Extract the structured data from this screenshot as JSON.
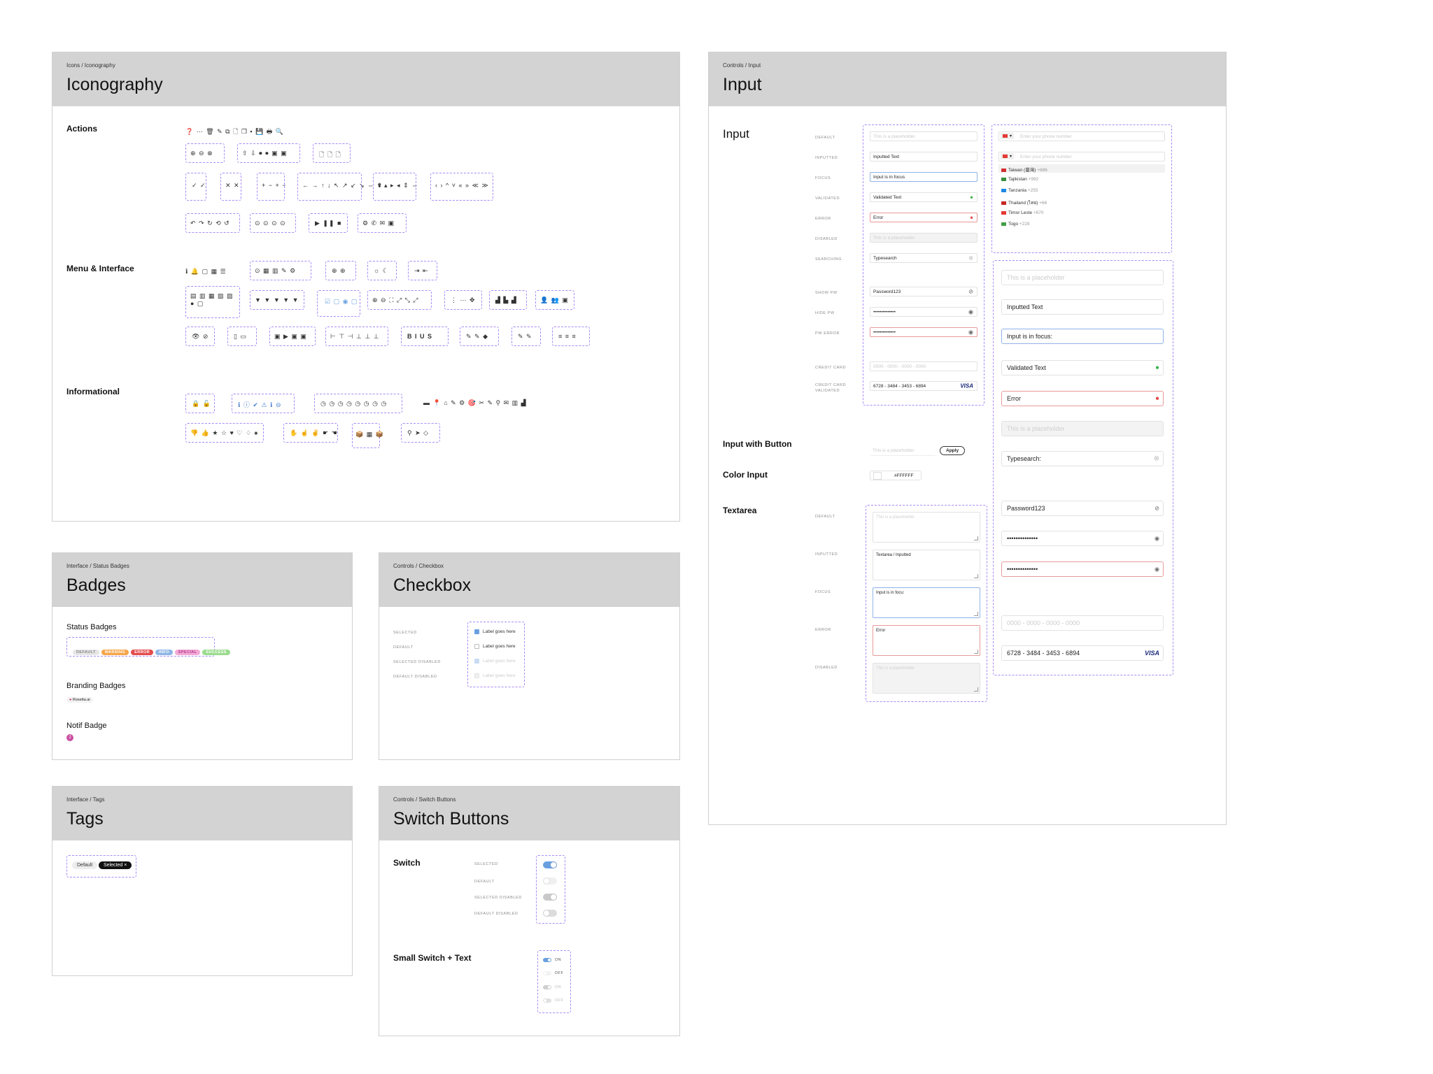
{
  "iconography": {
    "crumb": "Icons / Iconography",
    "title": "Iconography",
    "sections": {
      "actions": "Actions",
      "menu": "Menu & Interface",
      "info": "Informational"
    },
    "actions_row1": "❓ ⋯ 🗑 ✎ ⧉ 🗋 ❐ ▪ 💾 🖶 🔍",
    "actions_g1": "⊕ ⊖ ⊗",
    "actions_g2": "⇧ ⇩ ⏺ ⏺ ▣ ▣",
    "actions_g3": "🗋 🗋 🗋",
    "actions_g4": "✓ ✓",
    "actions_g5": "✕ ✕",
    "actions_g6": "+ − + −",
    "actions_g7": "← → ↑ ↓ ↖ ↗ ↙ ↘ ⇔ ⇕",
    "actions_g8": "▾ ▴ ▸ ◂ ⇕ ⇔",
    "actions_g9": "‹ › ^ ˅ « » ≪ ≫",
    "actions_g10": "↶ ↷ ↻ ⟲ ↺",
    "actions_g11": "⊙ ⊙ ⊙ ⊙",
    "actions_g12": "▶ ❚❚ ■",
    "actions_g13": "⚙ ✆ ✉ ▣",
    "menu_row1": "ℹ 🔔 ▢ ▦ ☰",
    "menu_g1": "⊙ ▦ ▥ ✎ ⚙",
    "menu_g2": "⊕ ⊕",
    "menu_g3": "☼ ☾",
    "menu_g4": "⇥ ⇤",
    "menu_g5": "▤ ▥ ▦ ▧ ▨ ● ▢",
    "menu_g6": "▼ ▼ ▼ ▼ ▼",
    "menu_g7": "☑ ▢ ◉ ▢",
    "menu_g8": "⊕ ⊖ ⛶ ⤢ ⤡ ⤢",
    "menu_g9": "⋮ ⋯ ✥",
    "menu_g10": "▟ ▙ ▟",
    "menu_g11": "👤 👥 ▣",
    "menu_g12": "👁 ⊘",
    "menu_g13": "▯ ▭",
    "menu_g14": "▣ ▶ ▣ ▣",
    "menu_g15": "⊢ ⊤ ⊣ ⊥ ⊥ ⊥",
    "menu_g16": "B I U S",
    "menu_g17": "✎ ✎ ◆",
    "menu_g18": "✎ ✎",
    "menu_g19": "≡ ≡ ≡",
    "info_g1": "🔒 🔓",
    "info_g2": "ℹ ⓘ ✔ ⚠ ℹ ⊖",
    "info_g3": "◷ ◷ ◷ ◷ ◷ ◷ ◷ ◷",
    "info_row": "▬ 📍 ⌂ ✎ ⚙ 🎯 ✂ ✎ ⚲ ✉ ▥ ▟",
    "info_g4": "👎 👍 ★ ☆ ♥ ♡ ♢ ♠",
    "info_g5": "✋ ☝ ✌ ☛ ☚",
    "info_g6": "📦 ▦ 📦",
    "info_g7": "⚲ ➤ ◇"
  },
  "input": {
    "crumb": "Controls / Input",
    "title": "Input",
    "sections": {
      "input": "Input",
      "with_button": "Input with Button",
      "color": "Color Input",
      "textarea": "Textarea"
    },
    "state_labels": [
      "DEFAULT",
      "INPUTTED",
      "FOCUS",
      "VALIDATED",
      "ERROR",
      "DISABLED",
      "SEARCHING",
      "SHOW PW",
      "HIDE PW",
      "PW ERROR",
      "CREDIT CARD",
      "CREDIT CARD VALIDATED"
    ],
    "placeholder": "This is a placeholder",
    "inputted": "Inputted Text",
    "focus": "Input is in focus",
    "focus_lg": "Input is in focus:",
    "validated": "Validated Text",
    "error": "Error",
    "searching": "Typesearch",
    "searching_lg": "Typesearch:",
    "password": "Password123",
    "masked": "••••••••••••••",
    "cc_placeholder": "0000 - 0000 - 0000 - 0000",
    "cc_value": "6728 - 3484 - 3453 - 6894",
    "visa": "VISA",
    "phone_placeholder": "Enter your phone number",
    "countries": [
      {
        "name": "Taiwan (臺灣)",
        "code": "+886"
      },
      {
        "name": "Tajikistan",
        "code": "+992"
      },
      {
        "name": "Tanzania",
        "code": "+255"
      },
      {
        "name": "Thailand (ไทย)",
        "code": "+66"
      },
      {
        "name": "Timor Leste",
        "code": "+670"
      },
      {
        "name": "Togo",
        "code": "+228"
      }
    ],
    "apply": "Apply",
    "color_value": "#FFFFFF",
    "ta_labels": [
      "DEFAULT",
      "INPUTTED",
      "FOCUS",
      "ERROR",
      "DISABLED"
    ],
    "ta_inputted": "Textarea / Inputted",
    "ta_focus": "Input is in focu:",
    "ta_error": "Error"
  },
  "badges": {
    "crumb": "Interface / Status Badges",
    "title": "Badges",
    "status_title": "Status Badges",
    "status": [
      {
        "label": "DEFAULT",
        "bg": "#e6e6e6",
        "fg": "#888"
      },
      {
        "label": "WARNING",
        "bg": "#f6a64a",
        "fg": "#fff"
      },
      {
        "label": "ERROR",
        "bg": "#e44d4d",
        "fg": "#fff"
      },
      {
        "label": "INFO",
        "bg": "#8fb6e6",
        "fg": "#fff"
      },
      {
        "label": "SPECIAL",
        "bg": "#f3a9d6",
        "fg": "#b43d8a"
      },
      {
        "label": "SUCCESS",
        "bg": "#9bdc8f",
        "fg": "#fff"
      }
    ],
    "branding_title": "Branding Badges",
    "branding_label": "Rosetta.ai",
    "notif_title": "Notif Badge",
    "notif_count": "2"
  },
  "checkbox": {
    "crumb": "Controls / Checkbox",
    "title": "Checkbox",
    "labels": [
      "SELECTED",
      "DEFAULT",
      "SELECTED DISABLED",
      "DEFAULT DISABLED"
    ],
    "item": "Label goes here"
  },
  "tags": {
    "crumb": "Interface / Tags",
    "title": "Tags",
    "default": "Default",
    "selected": "Selected",
    "close": "×"
  },
  "switches": {
    "crumb": "Controls / Switch Buttons",
    "title": "Switch Buttons",
    "switch_title": "Switch",
    "labels": [
      "SELECTED",
      "DEFAULT",
      "SELECTED DISABLED",
      "DEFAULT DISABLED"
    ],
    "small_title": "Small Switch + Text",
    "small": [
      "ON",
      "OFF",
      "ON",
      "OFF"
    ]
  }
}
